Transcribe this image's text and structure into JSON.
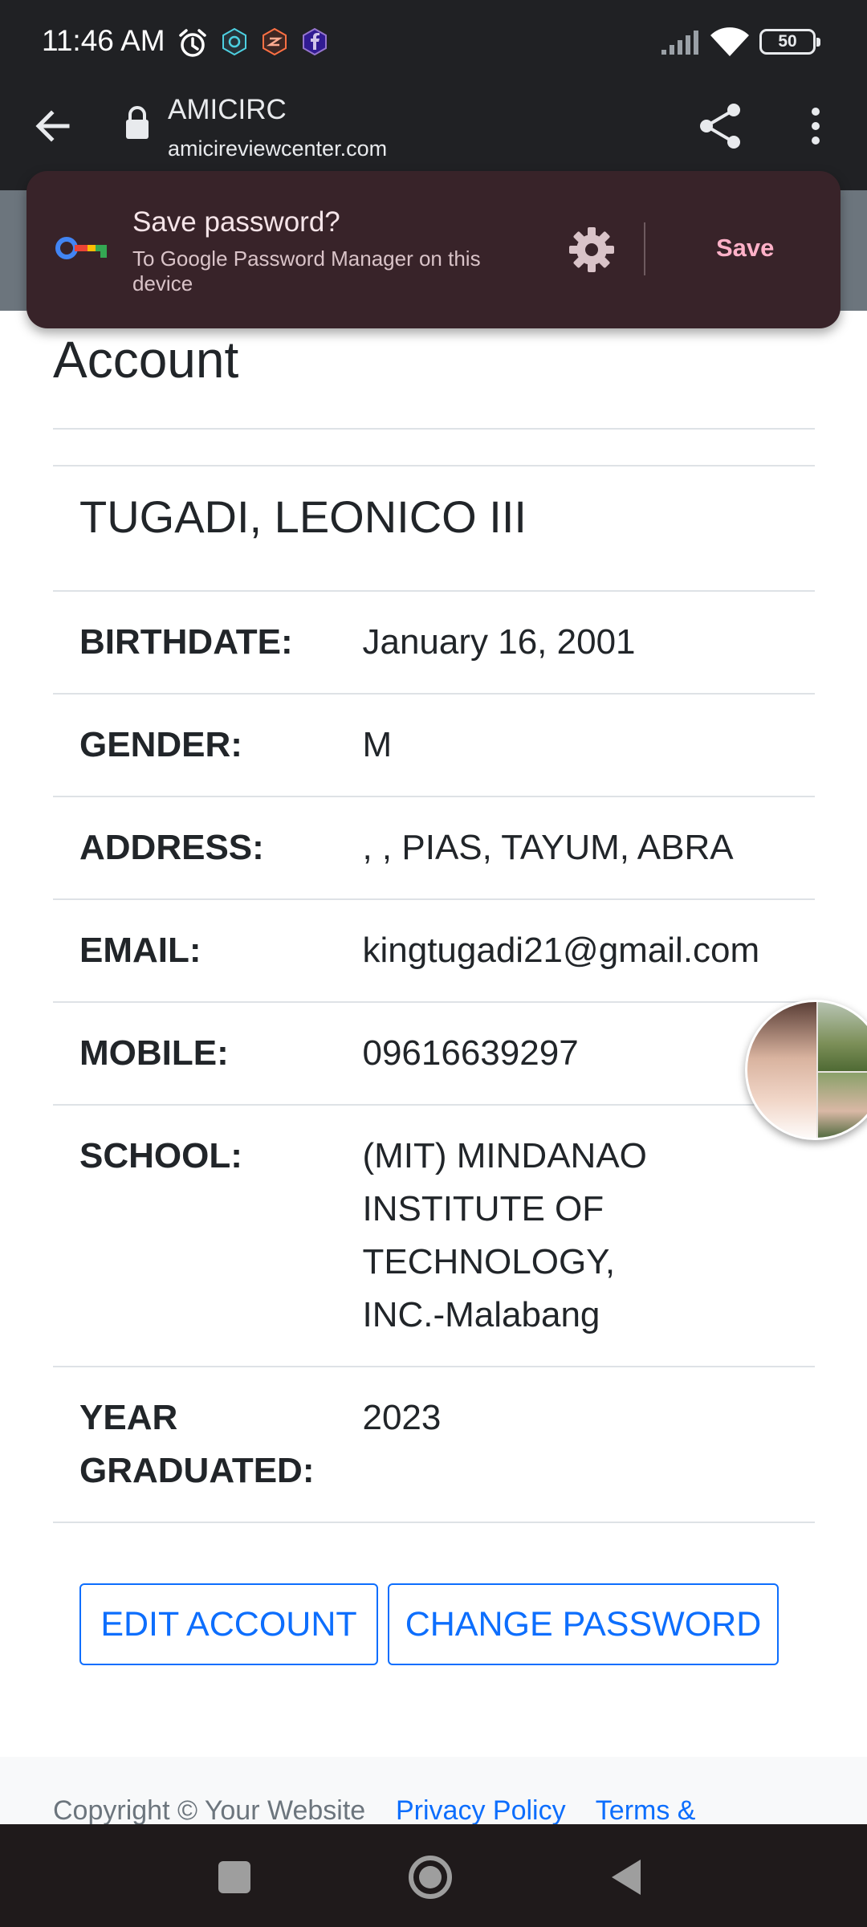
{
  "status_bar": {
    "time": "11:46 AM",
    "battery_level": "50"
  },
  "browser": {
    "site_title": "AMICIRC",
    "site_url": "amicireviewcenter.com"
  },
  "password_prompt": {
    "title": "Save password?",
    "subtitle": "To Google Password Manager on this device",
    "save_label": "Save"
  },
  "page": {
    "title": "Account",
    "name": "TUGADI, LEONICO III",
    "fields": [
      {
        "label": "BIRTHDATE:",
        "value": "January 16, 2001"
      },
      {
        "label": "GENDER:",
        "value": "M"
      },
      {
        "label": "ADDRESS:",
        "value": ", , PIAS, TAYUM, ABRA"
      },
      {
        "label": "EMAIL:",
        "value": "kingtugadi21@gmail.com"
      },
      {
        "label": "MOBILE:",
        "value": "09616639297"
      },
      {
        "label": "SCHOOL:",
        "value": "(MIT) MINDANAO INSTITUTE OF TECHNOLOGY, INC.-Malabang"
      },
      {
        "label": "YEAR GRADUATED:",
        "value": "2023"
      }
    ],
    "edit_account_label": "EDIT ACCOUNT",
    "change_password_label": "CHANGE PASSWORD"
  },
  "footer": {
    "copyright": "Copyright © Your Website",
    "privacy_link": "Privacy Policy",
    "terms_link": "Terms &"
  },
  "colors": {
    "accent": "#0d6efd",
    "popup_bg": "#382329",
    "popup_save": "#ffb1c8",
    "chrome_bar": "#202124"
  },
  "icons": {
    "status": [
      "alarm-icon",
      "app-icon",
      "app-icon",
      "facebook-icon",
      "signal-icon",
      "wifi-icon",
      "battery-icon"
    ],
    "browser": [
      "back-arrow-icon",
      "lock-icon",
      "share-icon",
      "more-vert-icon"
    ],
    "popup": [
      "key-icon",
      "gear-icon"
    ],
    "nav": [
      "recents-icon",
      "home-icon",
      "back-icon"
    ]
  }
}
